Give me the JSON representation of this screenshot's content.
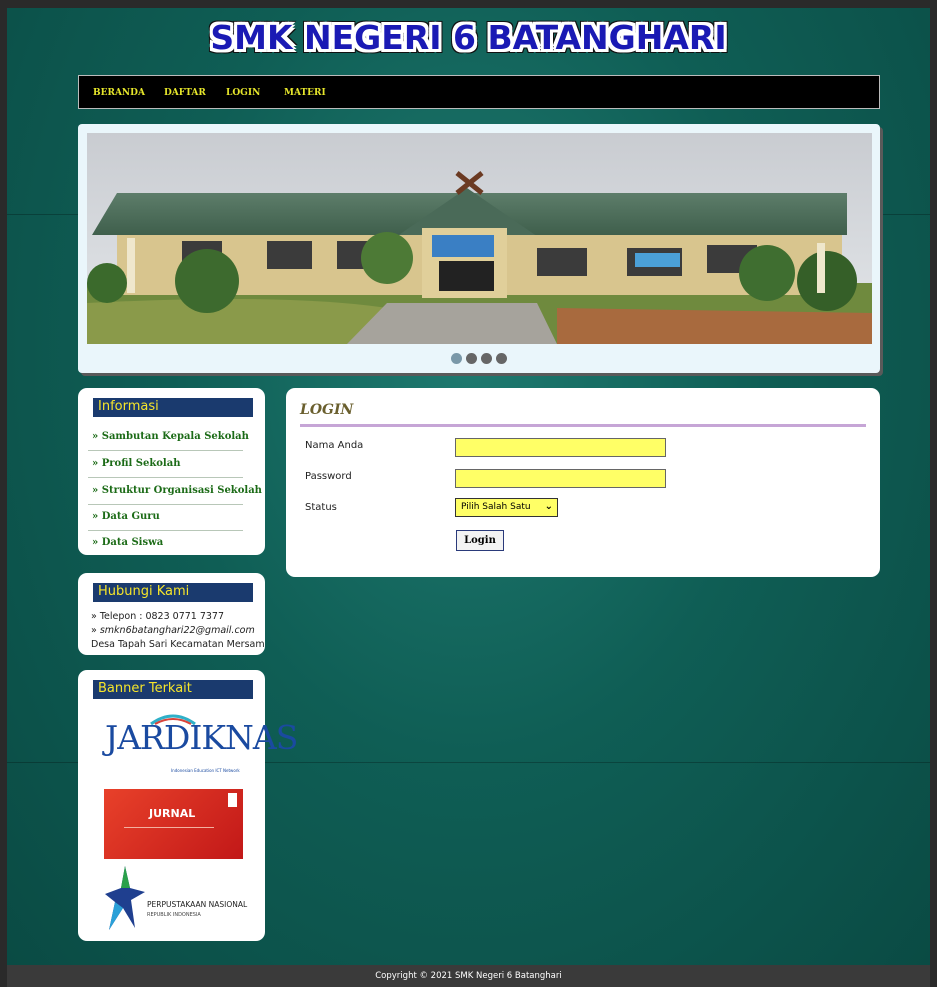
{
  "site": {
    "title": "SMK NEGERI 6 BATANGHARI"
  },
  "nav": {
    "items": [
      "BERANDA",
      "DAFTAR",
      "LOGIN",
      "MATERI"
    ]
  },
  "slider": {
    "dots": 4,
    "active_index": 0
  },
  "sidebar": {
    "informasi": {
      "title": "Informasi",
      "items": [
        "» Sambutan Kepala Sekolah",
        "» Profil Sekolah",
        "» Struktur Organisasi Sekolah",
        "» Data Guru",
        "» Data Siswa"
      ]
    },
    "kontak": {
      "title": "Hubungi Kami",
      "telepon": "» Telepon : 0823 0771 7377",
      "email_prefix": "» ",
      "email": "smkn6batanghari22@gmail.com",
      "alamat": "Desa Tapah Sari Kecamatan Mersam"
    },
    "banner": {
      "title": "Banner Terkait",
      "jardiknas": "JARDIKNAS",
      "jardiknas_sub": "Indonesian Education ICT Network",
      "jurnal": "JURNAL",
      "perpustakaan": "PERPUSTAKAAN NASIONAL",
      "perpustakaan_sub": "REPUBLIK INDONESIA"
    }
  },
  "login": {
    "title": "LOGIN",
    "name_label": "Nama Anda",
    "password_label": "Password",
    "status_label": "Status",
    "status_value": "Pilih Salah Satu",
    "button": "Login"
  },
  "footer": {
    "text": "Copyright © 2021 SMK Negeri 6 Batanghari"
  },
  "colors": {
    "nav_text": "#e6e62b",
    "side_head": "#1a3a6e",
    "side_head_text": "#f6e52a",
    "input_bg": "#ffff66"
  }
}
